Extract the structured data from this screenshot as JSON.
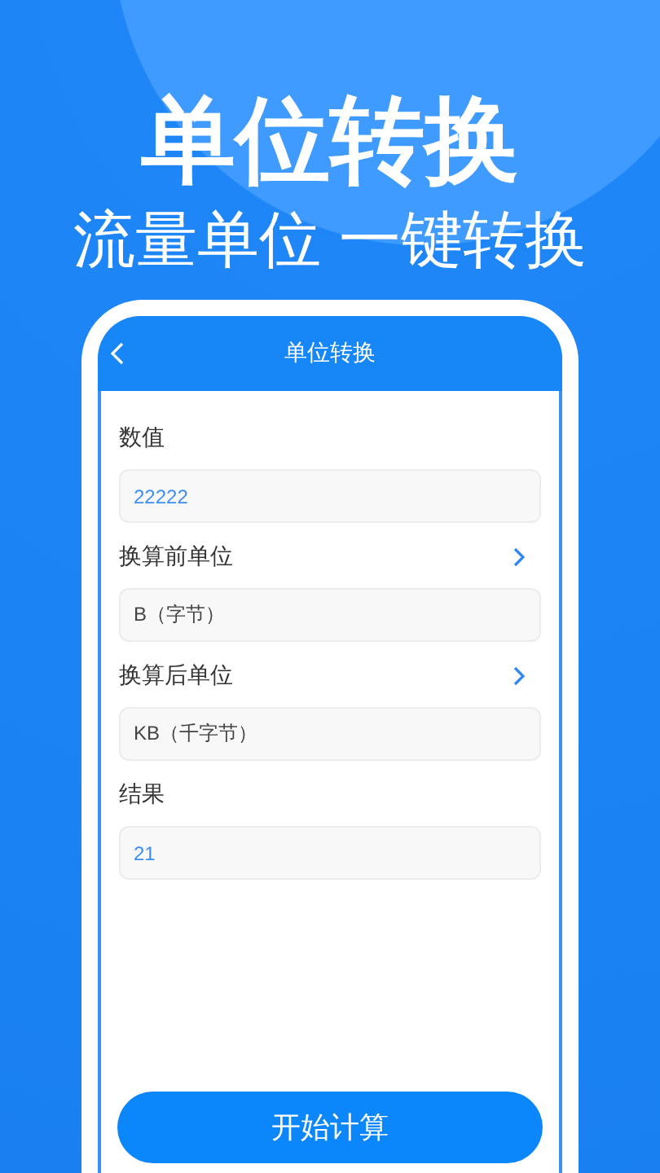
{
  "headline": "单位转换",
  "subheadline": "流量单位 一键转换",
  "screen": {
    "title": "单位转换",
    "fields": [
      {
        "kind": "input",
        "label": "数值",
        "value": "22222"
      },
      {
        "kind": "picker",
        "label": "换算前单位",
        "value": "B（字节）"
      },
      {
        "kind": "picker",
        "label": "换算后单位",
        "value": "KB（千字节）"
      },
      {
        "kind": "input",
        "label": "结果",
        "value": "21"
      }
    ],
    "button": "开始计算"
  }
}
